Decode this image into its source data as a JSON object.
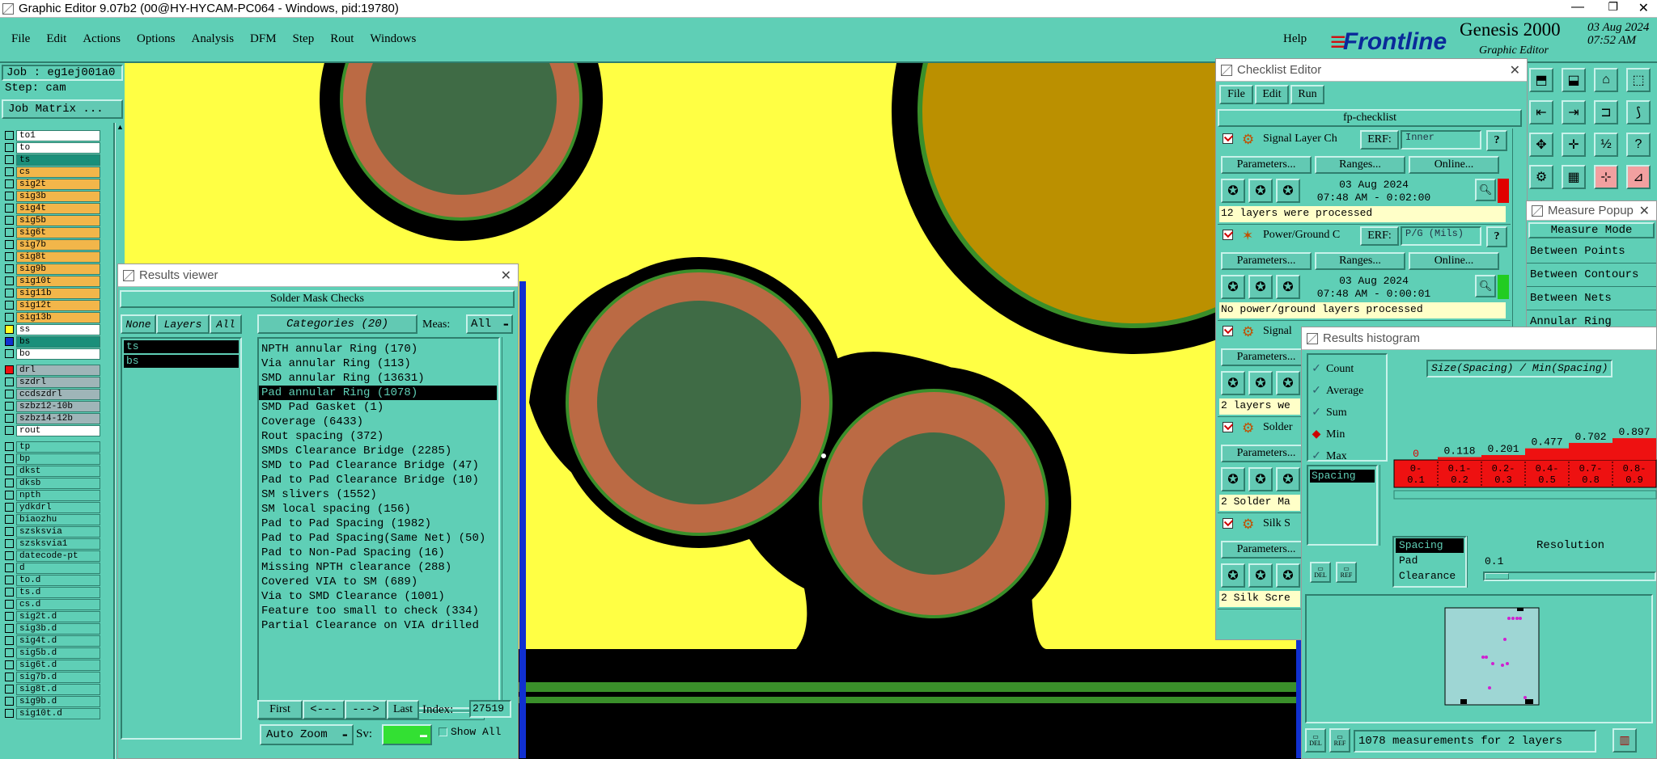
{
  "window": {
    "title": "Graphic Editor 9.07b2 (00@HY-HYCAM-PC064 - Windows, pid:19780)"
  },
  "menubar": {
    "items": [
      "File",
      "Edit",
      "Actions",
      "Options",
      "Analysis",
      "DFM",
      "Step",
      "Rout",
      "Windows"
    ],
    "help": "Help"
  },
  "brand": {
    "logo": "Frontline",
    "product": "Genesis 2000",
    "subtitle": "Graphic Editor",
    "date": "03 Aug 2024",
    "time": "07:52 AM"
  },
  "job": {
    "job_label": "Job : eg1ej001a0",
    "step_label": "Step: cam",
    "matrix_button": "Job Matrix ..."
  },
  "layers": [
    {
      "name": "to1",
      "color": "#ffffff",
      "mark": "none"
    },
    {
      "name": "to",
      "color": "#ffffff",
      "mark": "none"
    },
    {
      "name": "ts",
      "color": "#1a8f7a",
      "mark": "none"
    },
    {
      "name": "cs",
      "color": "#f2b64a",
      "mark": "none"
    },
    {
      "name": "sig2t",
      "color": "#f2b64a",
      "mark": "none"
    },
    {
      "name": "sig3b",
      "color": "#f2b64a",
      "mark": "none"
    },
    {
      "name": "sig4t",
      "color": "#f2b64a",
      "mark": "none"
    },
    {
      "name": "sig5b",
      "color": "#f2b64a",
      "mark": "none"
    },
    {
      "name": "sig6t",
      "color": "#f2b64a",
      "mark": "none"
    },
    {
      "name": "sig7b",
      "color": "#f2b64a",
      "mark": "none"
    },
    {
      "name": "sig8t",
      "color": "#f2b64a",
      "mark": "none"
    },
    {
      "name": "sig9b",
      "color": "#f2b64a",
      "mark": "none"
    },
    {
      "name": "sig10t",
      "color": "#f2b64a",
      "mark": "none"
    },
    {
      "name": "sig11b",
      "color": "#f2b64a",
      "mark": "none"
    },
    {
      "name": "sig12t",
      "color": "#f2b64a",
      "mark": "none"
    },
    {
      "name": "sig13b",
      "color": "#f2b64a",
      "mark": "none"
    },
    {
      "name": "ss",
      "color": "#ffffff",
      "mark": "yellow"
    },
    {
      "name": "bs",
      "color": "#1a8f7a",
      "mark": "blue"
    },
    {
      "name": "bo",
      "color": "#ffffff",
      "mark": "none"
    },
    {
      "name": "drl",
      "color": "#9fb5b8",
      "mark": "red"
    },
    {
      "name": "szdrl",
      "color": "#9fb5b8",
      "mark": "none"
    },
    {
      "name": "ccdszdrl",
      "color": "#9fb5b8",
      "mark": "none"
    },
    {
      "name": "szbz12-10b",
      "color": "#9fb5b8",
      "mark": "none"
    },
    {
      "name": "szbz14-12b",
      "color": "#9fb5b8",
      "mark": "none"
    },
    {
      "name": "rout",
      "color": "#ffffff",
      "mark": "none"
    },
    {
      "name": "tp",
      "color": "#5fcfb6",
      "mark": "none"
    },
    {
      "name": "bp",
      "color": "#5fcfb6",
      "mark": "none"
    },
    {
      "name": "dkst",
      "color": "#5fcfb6",
      "mark": "none"
    },
    {
      "name": "dksb",
      "color": "#5fcfb6",
      "mark": "none"
    },
    {
      "name": "npth",
      "color": "#5fcfb6",
      "mark": "none"
    },
    {
      "name": "ydkdrl",
      "color": "#5fcfb6",
      "mark": "none"
    },
    {
      "name": "biaozhu",
      "color": "#5fcfb6",
      "mark": "none"
    },
    {
      "name": "szsksvia",
      "color": "#5fcfb6",
      "mark": "none"
    },
    {
      "name": "szsksvia1",
      "color": "#5fcfb6",
      "mark": "none"
    },
    {
      "name": "datecode-pt",
      "color": "#5fcfb6",
      "mark": "none"
    },
    {
      "name": "d",
      "color": "#5fcfb6",
      "mark": "none"
    },
    {
      "name": "to.d",
      "color": "#5fcfb6",
      "mark": "none"
    },
    {
      "name": "ts.d",
      "color": "#5fcfb6",
      "mark": "none"
    },
    {
      "name": "cs.d",
      "color": "#5fcfb6",
      "mark": "none"
    },
    {
      "name": "sig2t.d",
      "color": "#5fcfb6",
      "mark": "none"
    },
    {
      "name": "sig3b.d",
      "color": "#5fcfb6",
      "mark": "none"
    },
    {
      "name": "sig4t.d",
      "color": "#5fcfb6",
      "mark": "none"
    },
    {
      "name": "sig5b.d",
      "color": "#5fcfb6",
      "mark": "none"
    },
    {
      "name": "sig6t.d",
      "color": "#5fcfb6",
      "mark": "none"
    },
    {
      "name": "sig7b.d",
      "color": "#5fcfb6",
      "mark": "none"
    },
    {
      "name": "sig8t.d",
      "color": "#5fcfb6",
      "mark": "none"
    },
    {
      "name": "sig9b.d",
      "color": "#5fcfb6",
      "mark": "none"
    },
    {
      "name": "sig10t.d",
      "color": "#5fcfb6",
      "mark": "none"
    }
  ],
  "results_viewer": {
    "title": "Results viewer",
    "header": "Solder Mask Checks",
    "none_btn": "None",
    "layers_btn": "Layers",
    "all_btn": "All",
    "categories_btn": "Categories (20)",
    "meas_label": "Meas:",
    "meas_value": "All",
    "selected_layers": [
      "ts",
      "bs"
    ],
    "categories": [
      "NPTH annular Ring (170)",
      "Via annular Ring (113)",
      "SMD annular Ring (13631)",
      "Pad annular Ring (1078)",
      "SMD Pad Gasket (1)",
      "Coverage (6433)",
      "Rout spacing (372)",
      "SMDs Clearance Bridge (2285)",
      "SMD to Pad Clearance Bridge (47)",
      "Pad to Pad Clearance Bridge (10)",
      "SM slivers (1552)",
      "SM local spacing (156)",
      "Pad to Pad Spacing (1982)",
      "Pad to Pad Spacing(Same Net) (50)",
      "Pad to Non-Pad Spacing (16)",
      "Missing NPTH clearance (288)",
      "Covered VIA to SM (689)",
      "Via to SMD Clearance (1001)",
      "Feature too small to check (334)",
      "Partial Clearance on VIA drilled"
    ],
    "selected_category": 3,
    "nav": {
      "first": "First",
      "prev": "<---",
      "next": "--->",
      "last": "Last",
      "index_label": "Index:",
      "index_value": "27519"
    },
    "auto_zoom": "Auto Zoom",
    "sv_label": "Sv:",
    "show_all": "Show All"
  },
  "checklist": {
    "title": "Checklist Editor",
    "menu": [
      "File",
      "Edit",
      "Run"
    ],
    "name": "fp-checklist",
    "erf_label": "ERF:",
    "params_btn": "Parameters...",
    "ranges_btn": "Ranges...",
    "online_btn": "Online...",
    "items": [
      {
        "name": "Signal Layer Ch",
        "erf": "Inner",
        "date": "03 Aug 2024",
        "time": "07:48 AM - 0:02:00",
        "status": "12 layers were processed",
        "status_color": "#e00000"
      },
      {
        "name": "Power/Ground C",
        "erf": "P/G (Mils)",
        "date": "03 Aug 2024",
        "time": "07:48 AM - 0:00:01",
        "status": "No power/ground layers processed",
        "status_color": "#22cc22"
      },
      {
        "name": "Signal",
        "status": "2 layers we"
      },
      {
        "name": "Solder",
        "status": "2 Solder Ma"
      },
      {
        "name": "Silk S",
        "status": "2 Silk Scre"
      }
    ]
  },
  "measure_popup": {
    "title": "Measure Popup",
    "header": "Measure Mode",
    "items": [
      "Between Points",
      "Between Contours",
      "Between Nets",
      "Annular Ring"
    ]
  },
  "histogram": {
    "title": "Results histogram",
    "options": [
      "Count",
      "Average",
      "Sum",
      "Min",
      "Max"
    ],
    "selected_option": "Min",
    "measure_list": [
      "Spacing"
    ],
    "del": "DEL",
    "ref": "REF",
    "plot_title": "Size(Spacing) / Min(Spacing)",
    "type_list": [
      "Spacing",
      "Pad",
      "Clearance"
    ],
    "resolution_label": "Resolution",
    "resolution_value": "0.1",
    "footer": "1078 measurements for 2 layers"
  },
  "chart_data": {
    "type": "bar",
    "title": "Size(Spacing) / Min(Spacing)",
    "categories": [
      "0-\n0.1",
      "0.1-\n0.2",
      "0.2-\n0.3",
      "0.4-\n0.5",
      "0.7-\n0.8",
      "0.8-\n0.9"
    ],
    "category_labels": [
      "0-",
      "0.1-",
      "0.2-",
      "0.4-",
      "0.7-",
      "0.8-"
    ],
    "category_labels2": [
      "0.1",
      "0.2",
      "0.3",
      "0.5",
      "0.8",
      "0.9"
    ],
    "values": [
      0,
      0.118,
      0.201,
      0.477,
      0.702,
      0.897
    ],
    "value_labels": [
      "0",
      "0.118",
      "0.201",
      "0.477",
      "0.702",
      "0.897"
    ],
    "ylim": [
      0,
      1
    ],
    "bar_color": "#ee1111"
  }
}
